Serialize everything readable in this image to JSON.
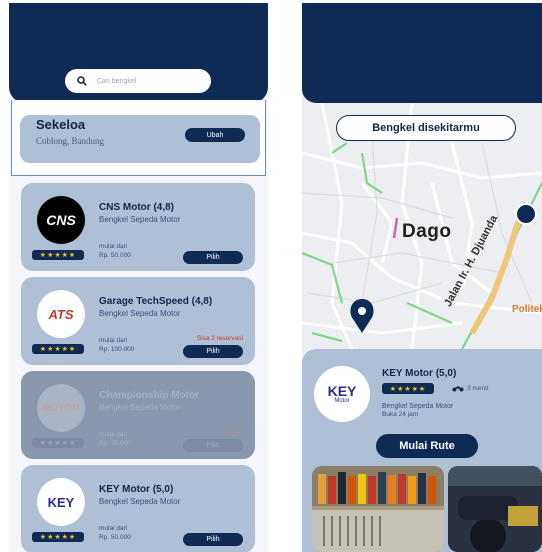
{
  "left": {
    "search": {
      "placeholder": "Cari bengkel"
    },
    "location": {
      "name": "Sekeloa",
      "area": "Coblong, Bandung",
      "change_label": "Ubah"
    },
    "workshops": [
      {
        "name": "CNS Motor (4,8)",
        "type": "Bengkel Sepeda Motor",
        "from_label": "mulai dari",
        "price": "Rp. 50.000",
        "rating_stars": "★★★★★",
        "button": "Pilih",
        "remark": "",
        "logo_text": "CNS"
      },
      {
        "name": "Garage TechSpeed (4,8)",
        "type": "Bengkel Sepeda Motor",
        "from_label": "mulai dari",
        "price": "Rp. 100.000",
        "rating_stars": "★★★★★",
        "button": "Pilih",
        "remark": "Sisa 2 reservasi",
        "logo_text": "ATS"
      },
      {
        "name": "Championship Motor",
        "type": "Bengkel Sepeda Motor",
        "from_label": "mulai dari",
        "price": "Rp. 70.000",
        "rating_stars": "★★★★★",
        "button": "Pilih",
        "remark": "Tutup",
        "logo_text": "MOTOR"
      },
      {
        "name": "KEY Motor (5,0)",
        "type": "Bengkel Sepeda Motor",
        "from_label": "mulai dari",
        "price": "Rp. 50.000",
        "rating_stars": "★★★★★",
        "button": "Pilih",
        "remark": "",
        "logo_text": "KEY"
      }
    ]
  },
  "right": {
    "nearby_label": "Bengkel disekitarmu",
    "map_labels": {
      "area": "Dago",
      "street": "Jalan Ir. H. Djuanda",
      "poi": "Politek"
    },
    "selected": {
      "name": "KEY Motor (5,0)",
      "rating_stars": "★★★★★",
      "distance": "3 menit",
      "type": "Bengkel Sepeda Motor",
      "hours": "Buka 24 jam",
      "route_label": "Mulai Rute",
      "logo_text": "KEY",
      "logo_sub": "Motor"
    }
  },
  "colors": {
    "primary": "#0e2b55",
    "card": "#aebfd6",
    "star": "#f6c21a",
    "remark": "#c0392b"
  }
}
